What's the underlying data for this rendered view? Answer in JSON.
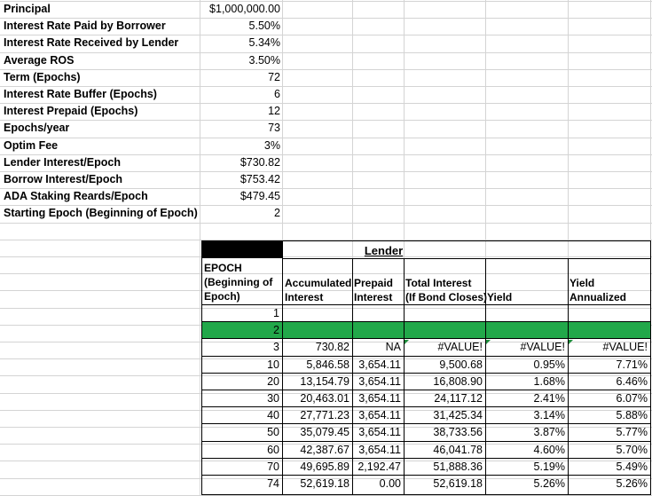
{
  "params": [
    {
      "label": "Principal",
      "value": "$1,000,000.00"
    },
    {
      "label": "Interest Rate Paid by Borrower",
      "value": "5.50%"
    },
    {
      "label": "Interest Rate Received by Lender",
      "value": "5.34%"
    },
    {
      "label": "Average ROS",
      "value": "3.50%"
    },
    {
      "label": "Term (Epochs)",
      "value": "72"
    },
    {
      "label": "Interest Rate Buffer (Epochs)",
      "value": "6"
    },
    {
      "label": "Interest Prepaid (Epochs)",
      "value": "12"
    },
    {
      "label": "Epochs/year",
      "value": "73"
    },
    {
      "label": "Optim Fee",
      "value": "3%"
    },
    {
      "label": "Lender Interest/Epoch",
      "value": "$730.82"
    },
    {
      "label": "Borrow Interest/Epoch",
      "value": "$753.42"
    },
    {
      "label": "ADA Staking Reards/Epoch",
      "value": "$479.45"
    },
    {
      "label": "Starting Epoch (Beginning of Epoch)",
      "value": "2"
    }
  ],
  "table": {
    "group_header": "Lender",
    "headers": {
      "epoch": [
        "EPOCH",
        "(Beginning of",
        "Epoch)"
      ],
      "accumulated": [
        "Accumulated",
        "Interest"
      ],
      "prepaid": [
        "Prepaid",
        "Interest"
      ],
      "total": [
        "Total Interest",
        "(If Bond Closes)"
      ],
      "yield": [
        "Yield"
      ],
      "annualized": [
        "Yield",
        "Annualized"
      ]
    },
    "rows": [
      {
        "epoch": "1",
        "acc": "",
        "pre": "",
        "tot": "",
        "yld": "",
        "ann": "",
        "style": "plain"
      },
      {
        "epoch": "2",
        "acc": "",
        "pre": "",
        "tot": "",
        "yld": "",
        "ann": "",
        "style": "green"
      },
      {
        "epoch": "3",
        "acc": "730.82",
        "pre": "NA",
        "tot": "#VALUE!",
        "yld": "#VALUE!",
        "ann": "#VALUE!",
        "style": "plain"
      },
      {
        "epoch": "10",
        "acc": "5,846.58",
        "pre": "3,654.11",
        "tot": "9,500.68",
        "yld": "0.95%",
        "ann": "7.71%",
        "style": "plain"
      },
      {
        "epoch": "20",
        "acc": "13,154.79",
        "pre": "3,654.11",
        "tot": "16,808.90",
        "yld": "1.68%",
        "ann": "6.46%",
        "style": "plain"
      },
      {
        "epoch": "30",
        "acc": "20,463.01",
        "pre": "3,654.11",
        "tot": "24,117.12",
        "yld": "2.41%",
        "ann": "6.07%",
        "style": "plain"
      },
      {
        "epoch": "40",
        "acc": "27,771.23",
        "pre": "3,654.11",
        "tot": "31,425.34",
        "yld": "3.14%",
        "ann": "5.88%",
        "style": "plain"
      },
      {
        "epoch": "50",
        "acc": "35,079.45",
        "pre": "3,654.11",
        "tot": "38,733.56",
        "yld": "3.87%",
        "ann": "5.77%",
        "style": "plain"
      },
      {
        "epoch": "60",
        "acc": "42,387.67",
        "pre": "3,654.11",
        "tot": "46,041.78",
        "yld": "4.60%",
        "ann": "5.70%",
        "style": "plain"
      },
      {
        "epoch": "70",
        "acc": "49,695.89",
        "pre": "2,192.47",
        "tot": "51,888.36",
        "yld": "5.19%",
        "ann": "5.49%",
        "style": "plain"
      },
      {
        "epoch": "74",
        "acc": "52,619.18",
        "pre": "0.00",
        "tot": "52,619.18",
        "yld": "5.26%",
        "ann": "5.26%",
        "style": "plain"
      }
    ]
  },
  "colors": {
    "green_row": "#22a84a",
    "grid": "#d4d4d4",
    "error_marker": "#1e8f3c"
  }
}
